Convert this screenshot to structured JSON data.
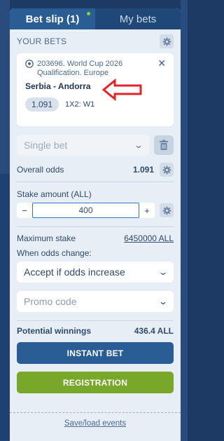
{
  "tabs": [
    {
      "label": "Bet slip (1)",
      "active": true
    },
    {
      "label": "My bets",
      "active": false
    }
  ],
  "your_bets_label": "YOUR BETS",
  "bet": {
    "event_line1": "203696. World Cup 2026",
    "event_line2": "Qualification. Europe",
    "match": "Serbia - Andorra",
    "odds": "1.091",
    "selection": "1X2: W1"
  },
  "bet_type": {
    "value": "Single bet"
  },
  "overall_odds": {
    "label": "Overall odds",
    "value": "1.091"
  },
  "stake": {
    "label": "Stake amount (ALL)",
    "minus": "−",
    "value": "400",
    "plus": "+"
  },
  "max_stake": {
    "label": "Maximum stake",
    "value": "6450000 ALL"
  },
  "odds_change": {
    "label": "When odds change:",
    "value": "Accept if odds increase"
  },
  "promo": {
    "placeholder": "Promo code"
  },
  "potential": {
    "label": "Potential winnings",
    "value": "436.4 ALL"
  },
  "buttons": {
    "instant": "INSTANT BET",
    "register": "REGISTRATION"
  },
  "footer_link": "Save/load events",
  "colors": {
    "primary": "#2b5d95",
    "green": "#79a72a",
    "panel": "#e8eef5",
    "arrow": "#e0242a"
  }
}
